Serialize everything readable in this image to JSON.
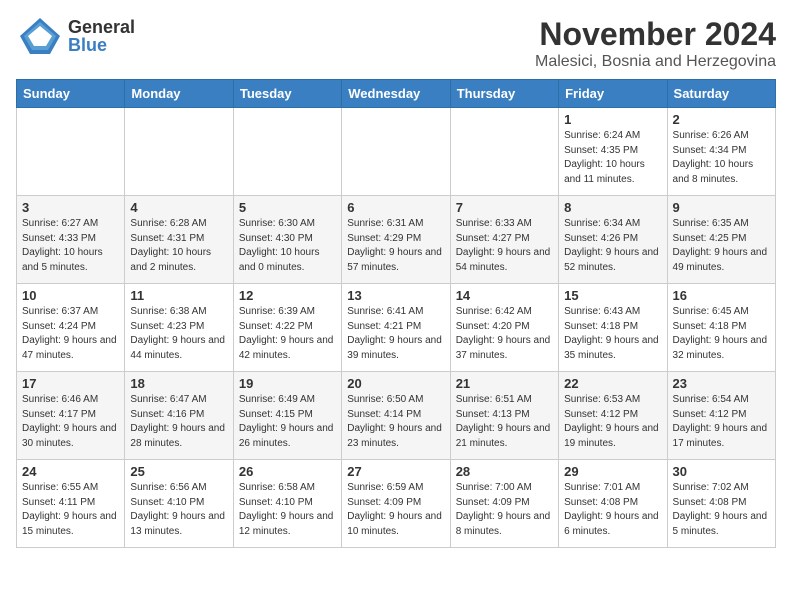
{
  "header": {
    "logo_general": "General",
    "logo_blue": "Blue",
    "month": "November 2024",
    "location": "Malesici, Bosnia and Herzegovina"
  },
  "weekdays": [
    "Sunday",
    "Monday",
    "Tuesday",
    "Wednesday",
    "Thursday",
    "Friday",
    "Saturday"
  ],
  "weeks": [
    [
      {
        "day": "",
        "info": ""
      },
      {
        "day": "",
        "info": ""
      },
      {
        "day": "",
        "info": ""
      },
      {
        "day": "",
        "info": ""
      },
      {
        "day": "",
        "info": ""
      },
      {
        "day": "1",
        "info": "Sunrise: 6:24 AM\nSunset: 4:35 PM\nDaylight: 10 hours and 11 minutes."
      },
      {
        "day": "2",
        "info": "Sunrise: 6:26 AM\nSunset: 4:34 PM\nDaylight: 10 hours and 8 minutes."
      }
    ],
    [
      {
        "day": "3",
        "info": "Sunrise: 6:27 AM\nSunset: 4:33 PM\nDaylight: 10 hours and 5 minutes."
      },
      {
        "day": "4",
        "info": "Sunrise: 6:28 AM\nSunset: 4:31 PM\nDaylight: 10 hours and 2 minutes."
      },
      {
        "day": "5",
        "info": "Sunrise: 6:30 AM\nSunset: 4:30 PM\nDaylight: 10 hours and 0 minutes."
      },
      {
        "day": "6",
        "info": "Sunrise: 6:31 AM\nSunset: 4:29 PM\nDaylight: 9 hours and 57 minutes."
      },
      {
        "day": "7",
        "info": "Sunrise: 6:33 AM\nSunset: 4:27 PM\nDaylight: 9 hours and 54 minutes."
      },
      {
        "day": "8",
        "info": "Sunrise: 6:34 AM\nSunset: 4:26 PM\nDaylight: 9 hours and 52 minutes."
      },
      {
        "day": "9",
        "info": "Sunrise: 6:35 AM\nSunset: 4:25 PM\nDaylight: 9 hours and 49 minutes."
      }
    ],
    [
      {
        "day": "10",
        "info": "Sunrise: 6:37 AM\nSunset: 4:24 PM\nDaylight: 9 hours and 47 minutes."
      },
      {
        "day": "11",
        "info": "Sunrise: 6:38 AM\nSunset: 4:23 PM\nDaylight: 9 hours and 44 minutes."
      },
      {
        "day": "12",
        "info": "Sunrise: 6:39 AM\nSunset: 4:22 PM\nDaylight: 9 hours and 42 minutes."
      },
      {
        "day": "13",
        "info": "Sunrise: 6:41 AM\nSunset: 4:21 PM\nDaylight: 9 hours and 39 minutes."
      },
      {
        "day": "14",
        "info": "Sunrise: 6:42 AM\nSunset: 4:20 PM\nDaylight: 9 hours and 37 minutes."
      },
      {
        "day": "15",
        "info": "Sunrise: 6:43 AM\nSunset: 4:18 PM\nDaylight: 9 hours and 35 minutes."
      },
      {
        "day": "16",
        "info": "Sunrise: 6:45 AM\nSunset: 4:18 PM\nDaylight: 9 hours and 32 minutes."
      }
    ],
    [
      {
        "day": "17",
        "info": "Sunrise: 6:46 AM\nSunset: 4:17 PM\nDaylight: 9 hours and 30 minutes."
      },
      {
        "day": "18",
        "info": "Sunrise: 6:47 AM\nSunset: 4:16 PM\nDaylight: 9 hours and 28 minutes."
      },
      {
        "day": "19",
        "info": "Sunrise: 6:49 AM\nSunset: 4:15 PM\nDaylight: 9 hours and 26 minutes."
      },
      {
        "day": "20",
        "info": "Sunrise: 6:50 AM\nSunset: 4:14 PM\nDaylight: 9 hours and 23 minutes."
      },
      {
        "day": "21",
        "info": "Sunrise: 6:51 AM\nSunset: 4:13 PM\nDaylight: 9 hours and 21 minutes."
      },
      {
        "day": "22",
        "info": "Sunrise: 6:53 AM\nSunset: 4:12 PM\nDaylight: 9 hours and 19 minutes."
      },
      {
        "day": "23",
        "info": "Sunrise: 6:54 AM\nSunset: 4:12 PM\nDaylight: 9 hours and 17 minutes."
      }
    ],
    [
      {
        "day": "24",
        "info": "Sunrise: 6:55 AM\nSunset: 4:11 PM\nDaylight: 9 hours and 15 minutes."
      },
      {
        "day": "25",
        "info": "Sunrise: 6:56 AM\nSunset: 4:10 PM\nDaylight: 9 hours and 13 minutes."
      },
      {
        "day": "26",
        "info": "Sunrise: 6:58 AM\nSunset: 4:10 PM\nDaylight: 9 hours and 12 minutes."
      },
      {
        "day": "27",
        "info": "Sunrise: 6:59 AM\nSunset: 4:09 PM\nDaylight: 9 hours and 10 minutes."
      },
      {
        "day": "28",
        "info": "Sunrise: 7:00 AM\nSunset: 4:09 PM\nDaylight: 9 hours and 8 minutes."
      },
      {
        "day": "29",
        "info": "Sunrise: 7:01 AM\nSunset: 4:08 PM\nDaylight: 9 hours and 6 minutes."
      },
      {
        "day": "30",
        "info": "Sunrise: 7:02 AM\nSunset: 4:08 PM\nDaylight: 9 hours and 5 minutes."
      }
    ]
  ]
}
